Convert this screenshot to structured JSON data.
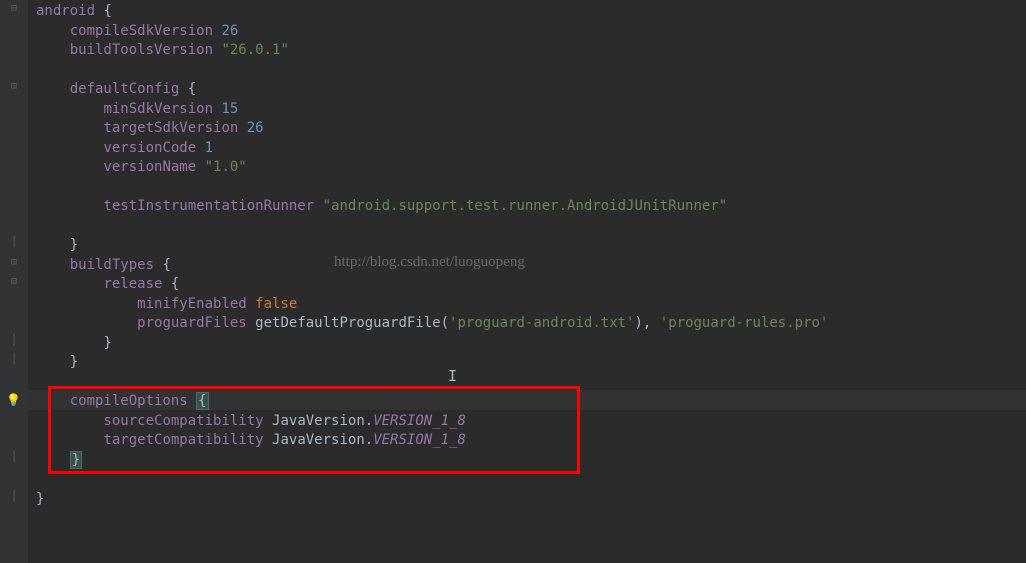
{
  "code": {
    "l0_block": "android",
    "l0_brace": " {",
    "l1_indent": "    ",
    "l1_prop": "compileSdkVersion",
    "l1_sp": " ",
    "l1_val": "26",
    "l2_indent": "    ",
    "l2_prop": "buildToolsVersion",
    "l2_sp": " ",
    "l2_val": "\"26.0.1\"",
    "l4_indent": "    ",
    "l4_block": "defaultConfig",
    "l4_brace": " {",
    "l5_indent": "        ",
    "l5_prop": "minSdkVersion",
    "l5_sp": " ",
    "l5_val": "15",
    "l6_indent": "        ",
    "l6_prop": "targetSdkVersion",
    "l6_sp": " ",
    "l6_val": "26",
    "l7_indent": "        ",
    "l7_prop": "versionCode",
    "l7_sp": " ",
    "l7_val": "1",
    "l8_indent": "        ",
    "l8_prop": "versionName",
    "l8_sp": " ",
    "l8_val": "\"1.0\"",
    "l10_indent": "        ",
    "l10_prop": "testInstrumentationRunner",
    "l10_sp": " ",
    "l10_val": "\"android.support.test.runner.AndroidJUnitRunner\"",
    "l12_indent": "    ",
    "l12_brace": "}",
    "l13_indent": "    ",
    "l13_block": "buildTypes",
    "l13_brace": " {",
    "l14_indent": "        ",
    "l14_block": "release",
    "l14_brace": " {",
    "l15_indent": "            ",
    "l15_prop": "minifyEnabled",
    "l15_sp": " ",
    "l15_val": "false",
    "l16_indent": "            ",
    "l16_prop": "proguardFiles",
    "l16_sp": " ",
    "l16_fn": "getDefaultProguardFile",
    "l16_paren1": "(",
    "l16_arg1": "'proguard-android.txt'",
    "l16_paren2": ")",
    "l16_comma": ", ",
    "l16_arg2": "'proguard-rules.pro'",
    "l17_indent": "        ",
    "l17_brace": "}",
    "l18_indent": "    ",
    "l18_brace": "}",
    "l20_indent": "    ",
    "l20_block": "compileOptions",
    "l20_brace": " {",
    "l21_indent": "        ",
    "l21_prop": "sourceCompatibility",
    "l21_sp": " ",
    "l21_cls": "JavaVersion",
    "l21_dot": ".",
    "l21_const": "VERSION_1_8",
    "l22_indent": "        ",
    "l22_prop": "targetCompatibility",
    "l22_sp": " ",
    "l22_cls": "JavaVersion",
    "l22_dot": ".",
    "l22_const": "VERSION_1_8",
    "l23_indent": "    ",
    "l23_brace": "}",
    "l25_brace": "}"
  },
  "watermark": "http://blog.csdn.net/luoguopeng",
  "cursor_char": "I",
  "fold_minus": "⊟",
  "fold_bar": "│",
  "bulb": "💡"
}
